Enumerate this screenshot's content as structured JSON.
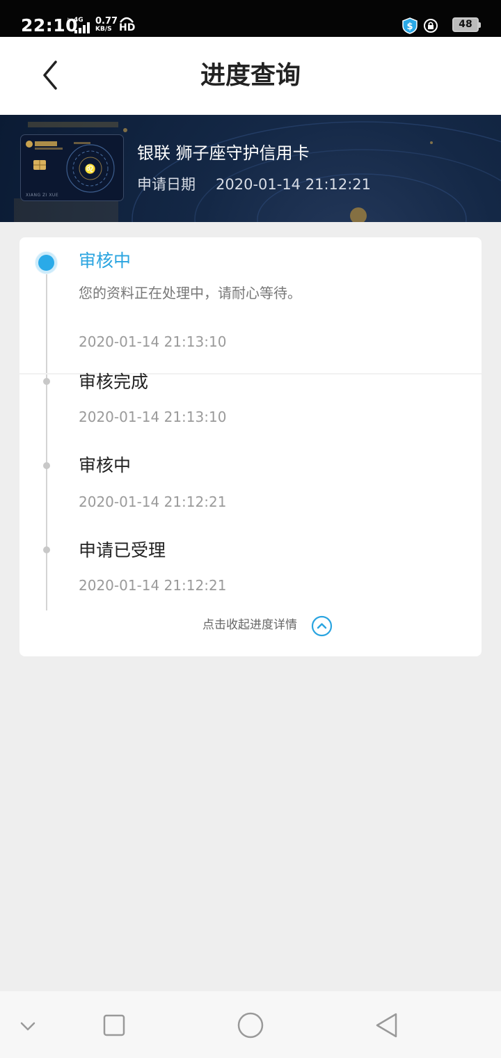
{
  "status_bar": {
    "time": "22:10",
    "network_type": "4G",
    "network_speed": "0.77",
    "network_speed_unit": "KB/S",
    "hd_label": "HD",
    "battery_level": "48"
  },
  "header": {
    "title": "进度查询",
    "back_icon": "chevron-left-icon"
  },
  "card": {
    "name": "银联 狮子座守护信用卡",
    "apply_date_label": "申请日期",
    "apply_date_value": "2020-01-14 21:12:21",
    "card_text": "XIANG ZI XUE"
  },
  "progress": {
    "current": {
      "title": "审核中",
      "description": "您的资料正在处理中，请耐心等待。",
      "time": "2020-01-14 21:13:10"
    },
    "history": [
      {
        "title": "审核完成",
        "time": "2020-01-14 21:13:10"
      },
      {
        "title": "审核中",
        "time": "2020-01-14 21:12:21"
      },
      {
        "title": "申请已受理",
        "time": "2020-01-14 21:12:21"
      }
    ],
    "collapse_label": "点击收起进度详情"
  },
  "colors": {
    "accent": "#2aa4e0",
    "banner_bg": "#142846",
    "page_bg": "#eeeeee"
  }
}
